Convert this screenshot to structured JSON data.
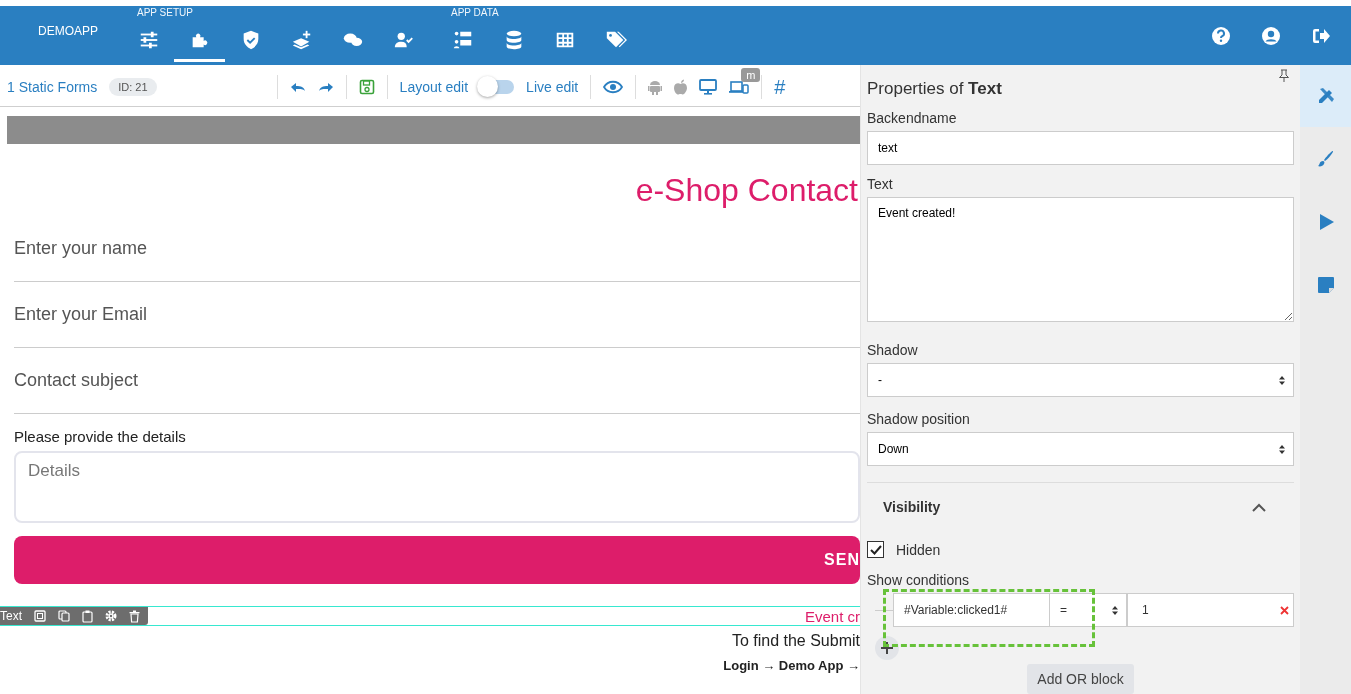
{
  "topbar": {
    "brand": "DEMOAPP",
    "groups": [
      {
        "label": "APP SETUP",
        "items": [
          {
            "selected": false
          },
          {
            "selected": true
          },
          {
            "selected": false
          },
          {
            "selected": false
          },
          {
            "selected": false
          },
          {
            "selected": false
          }
        ]
      },
      {
        "label": "APP DATA",
        "items": [
          {
            "selected": false
          },
          {
            "selected": false
          },
          {
            "selected": false
          },
          {
            "selected": false
          }
        ]
      }
    ]
  },
  "toolbar": {
    "breadcrumb": "1 Static Forms",
    "id_badge": "ID: 21",
    "layout_label": "Layout edit",
    "live_edit": false,
    "live_label": "Live edit",
    "device_badge": "m",
    "hash": "#"
  },
  "form": {
    "title": "e-Shop Contact",
    "fields": [
      {
        "placeholder": "Enter your name"
      },
      {
        "placeholder": "Enter your Email"
      },
      {
        "placeholder": "Contact subject"
      }
    ],
    "details_label": "Please provide the details",
    "details_placeholder": "Details",
    "send_button": "SEN",
    "selected_element": {
      "tag": "Text",
      "text": "Event cr"
    },
    "info": "To find the Submit",
    "path": "Login → Demo App →"
  },
  "properties": {
    "title": "Properties of **Text**",
    "backendname_label": "Backendname",
    "backendname": "text",
    "text_label": "Text",
    "text": "Event created!",
    "shadow_label": "Shadow",
    "shadow": "-",
    "shadow_position_label": "Shadow position",
    "shadow_position": "Down",
    "visibility": {
      "title": "Visibility",
      "expanded": true,
      "hidden_label": "Hidden",
      "hidden": true,
      "conditions_label": "Show conditions",
      "condition": {
        "variable": "#Variable:clicked1#",
        "operator": "=",
        "value": "1"
      },
      "add_or_block": "Add OR block"
    }
  },
  "side_tabs": [
    {
      "selected": true
    },
    {
      "selected": false
    },
    {
      "selected": false
    },
    {
      "selected": false
    }
  ]
}
